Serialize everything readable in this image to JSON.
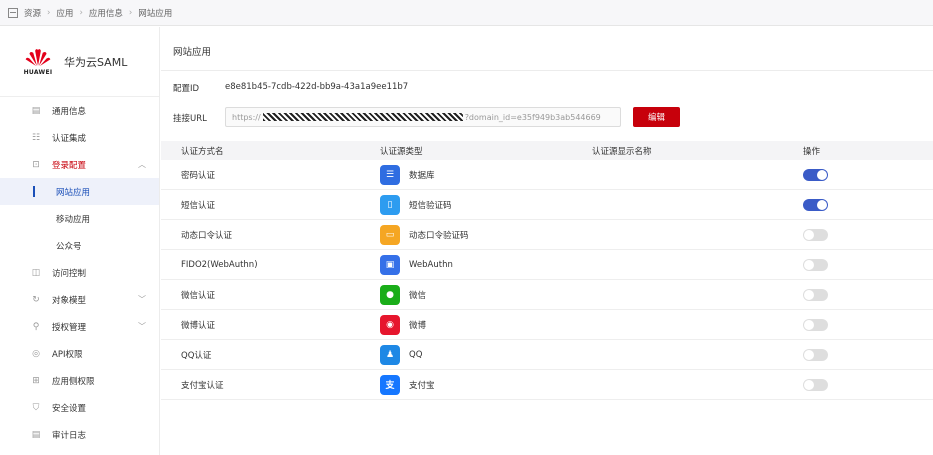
{
  "breadcrumb": [
    "资源",
    "应用",
    "应用信息",
    "网站应用"
  ],
  "brand": {
    "logo_text": "HUAWEI",
    "name": "华为云SAML"
  },
  "sidebar": {
    "items": [
      {
        "label": "通用信息",
        "icon": "doc-icon",
        "glyph": "▤"
      },
      {
        "label": "认证集成",
        "icon": "list-icon",
        "glyph": "☷"
      },
      {
        "label": "登录配置",
        "icon": "login-icon",
        "glyph": "⊡",
        "expanded": true
      },
      {
        "label": "网站应用",
        "sub": true,
        "active": true
      },
      {
        "label": "移动应用",
        "sub": true
      },
      {
        "label": "公众号",
        "sub": true
      },
      {
        "label": "访问控制",
        "icon": "access-icon",
        "glyph": "◫"
      },
      {
        "label": "对象模型",
        "icon": "model-icon",
        "glyph": "↻",
        "collapsed": true
      },
      {
        "label": "授权管理",
        "icon": "auth-icon",
        "glyph": "⚲",
        "collapsed": true
      },
      {
        "label": "API权限",
        "icon": "api-icon",
        "glyph": "◎"
      },
      {
        "label": "应用侧权限",
        "icon": "grid-icon",
        "glyph": "⊞"
      },
      {
        "label": "安全设置",
        "icon": "shield-icon",
        "glyph": "⛉"
      },
      {
        "label": "审计日志",
        "icon": "log-icon",
        "glyph": "▤"
      }
    ]
  },
  "main": {
    "title": "网站应用",
    "config_id_label": "配置ID",
    "config_id": "e8e81b45-7cdb-422d-bb9a-43a1a9ee11b7",
    "url_label": "挂接URL",
    "url_prefix": "https://",
    "url_suffix": "?domain_id=e35f949b3ab544669",
    "edit_label": "编辑",
    "columns": [
      "认证方式名",
      "认证源类型",
      "认证源显示名称",
      "操作"
    ],
    "rows": [
      {
        "name": "密码认证",
        "type": "数据库",
        "icon": "database-icon",
        "color": "#2f6de1",
        "glyph": "☰",
        "enabled": true
      },
      {
        "name": "短信认证",
        "type": "短信验证码",
        "icon": "sms-icon",
        "color": "#2d9cf0",
        "glyph": "▯",
        "enabled": true
      },
      {
        "name": "动态口令认证",
        "type": "动态口令验证码",
        "icon": "otp-icon",
        "color": "#f5a623",
        "glyph": "▭",
        "enabled": false
      },
      {
        "name": "FIDO2(WebAuthn)",
        "type": "WebAuthn",
        "icon": "webauthn-icon",
        "color": "#3570e8",
        "glyph": "▣",
        "enabled": false
      },
      {
        "name": "微信认证",
        "type": "微信",
        "icon": "wechat-icon",
        "color": "#1aad19",
        "glyph": "●",
        "enabled": false
      },
      {
        "name": "微博认证",
        "type": "微博",
        "icon": "weibo-icon",
        "color": "#e6162d",
        "glyph": "◉",
        "enabled": false
      },
      {
        "name": "QQ认证",
        "type": "QQ",
        "icon": "qq-icon",
        "color": "#1e88e5",
        "glyph": "♟",
        "enabled": false
      },
      {
        "name": "支付宝认证",
        "type": "支付宝",
        "icon": "alipay-icon",
        "color": "#1677ff",
        "glyph": "支",
        "enabled": false
      }
    ]
  }
}
